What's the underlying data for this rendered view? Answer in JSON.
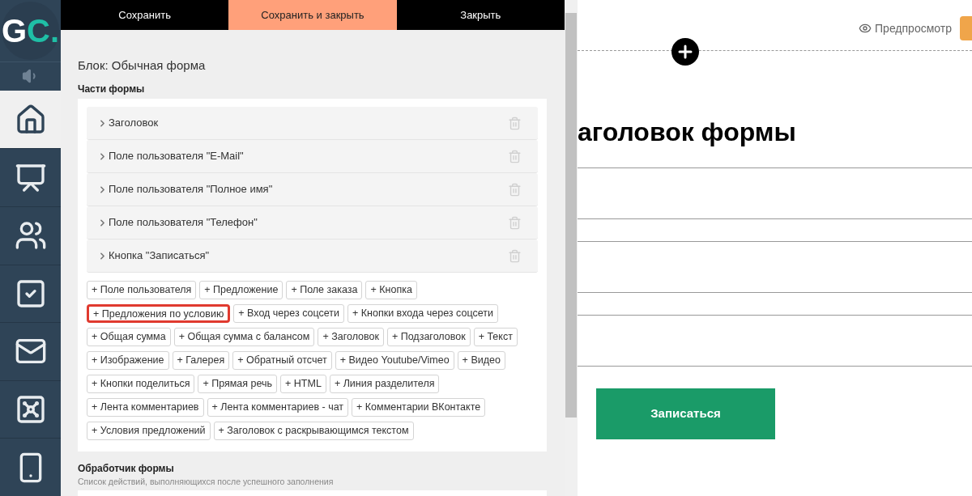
{
  "sidebar": {
    "logo": {
      "letters": "GC",
      "dot": "."
    },
    "items": [
      {
        "kind": "home",
        "selected": true
      },
      {
        "kind": "chart",
        "selected": false
      },
      {
        "kind": "users",
        "selected": false
      },
      {
        "kind": "tasks",
        "selected": false
      },
      {
        "kind": "mail",
        "selected": false
      },
      {
        "kind": "safe",
        "selected": false
      },
      {
        "kind": "phone",
        "selected": false
      }
    ]
  },
  "toolbar": [
    {
      "label": "Сохранить",
      "kind": "dark"
    },
    {
      "label": "Сохранить и закрыть",
      "kind": "accent"
    },
    {
      "label": "Закрыть",
      "kind": "dark"
    }
  ],
  "editor": {
    "title": "Блок: Обычная форма",
    "parts_heading": "Части формы",
    "parts": [
      {
        "label": "Заголовок"
      },
      {
        "label": "Поле пользователя \"E-Mail\""
      },
      {
        "label": "Поле пользователя \"Полное имя\""
      },
      {
        "label": "Поле пользователя \"Телефон\""
      },
      {
        "label": "Кнопка \"Записаться\""
      }
    ],
    "add_rows": [
      [
        {
          "label": "+ Поле пользователя",
          "highlighted": false
        },
        {
          "label": "+ Предложение",
          "highlighted": false
        },
        {
          "label": "+ Поле заказа",
          "highlighted": false
        },
        {
          "label": "+ Кнопка",
          "highlighted": false
        }
      ],
      [
        {
          "label": "+ Предложения по условию",
          "highlighted": true
        },
        {
          "label": "+ Вход через соцсети",
          "highlighted": false
        },
        {
          "label": "+ Кнопки входа через соцсети",
          "highlighted": false
        }
      ],
      [
        {
          "label": "+ Общая сумма",
          "highlighted": false
        },
        {
          "label": "+ Общая сумма с балансом",
          "highlighted": false
        },
        {
          "label": "+ Заголовок",
          "highlighted": false
        },
        {
          "label": "+ Подзаголовок",
          "highlighted": false
        },
        {
          "label": "+ Текст",
          "highlighted": false
        }
      ],
      [
        {
          "label": "+ Изображение",
          "highlighted": false
        },
        {
          "label": "+ Галерея",
          "highlighted": false
        },
        {
          "label": "+ Обратный отсчет",
          "highlighted": false
        },
        {
          "label": "+ Видео Youtube/Vimeo",
          "highlighted": false
        },
        {
          "label": "+ Видео",
          "highlighted": false
        }
      ],
      [
        {
          "label": "+ Кнопки поделиться",
          "highlighted": false
        },
        {
          "label": "+ Прямая речь",
          "highlighted": false
        },
        {
          "label": "+ HTML",
          "highlighted": false
        },
        {
          "label": "+ Линия разделителя",
          "highlighted": false
        }
      ],
      [
        {
          "label": "+ Лента комментариев",
          "highlighted": false
        },
        {
          "label": "+ Лента комментариев - чат",
          "highlighted": false
        },
        {
          "label": "+ Комментарии ВКонтакте",
          "highlighted": false
        }
      ],
      [
        {
          "label": "+ Условия предложений",
          "highlighted": false
        },
        {
          "label": "+ Заголовок с раскрывающимся текстом",
          "highlighted": false
        }
      ]
    ],
    "handler_heading": "Обработчик формы",
    "handler_hint": "Список действий, выполняющихся после успешного заполнения"
  },
  "preview": {
    "preview_link": "Предпросмотр",
    "title": "аголовок формы",
    "button": "Записаться"
  }
}
